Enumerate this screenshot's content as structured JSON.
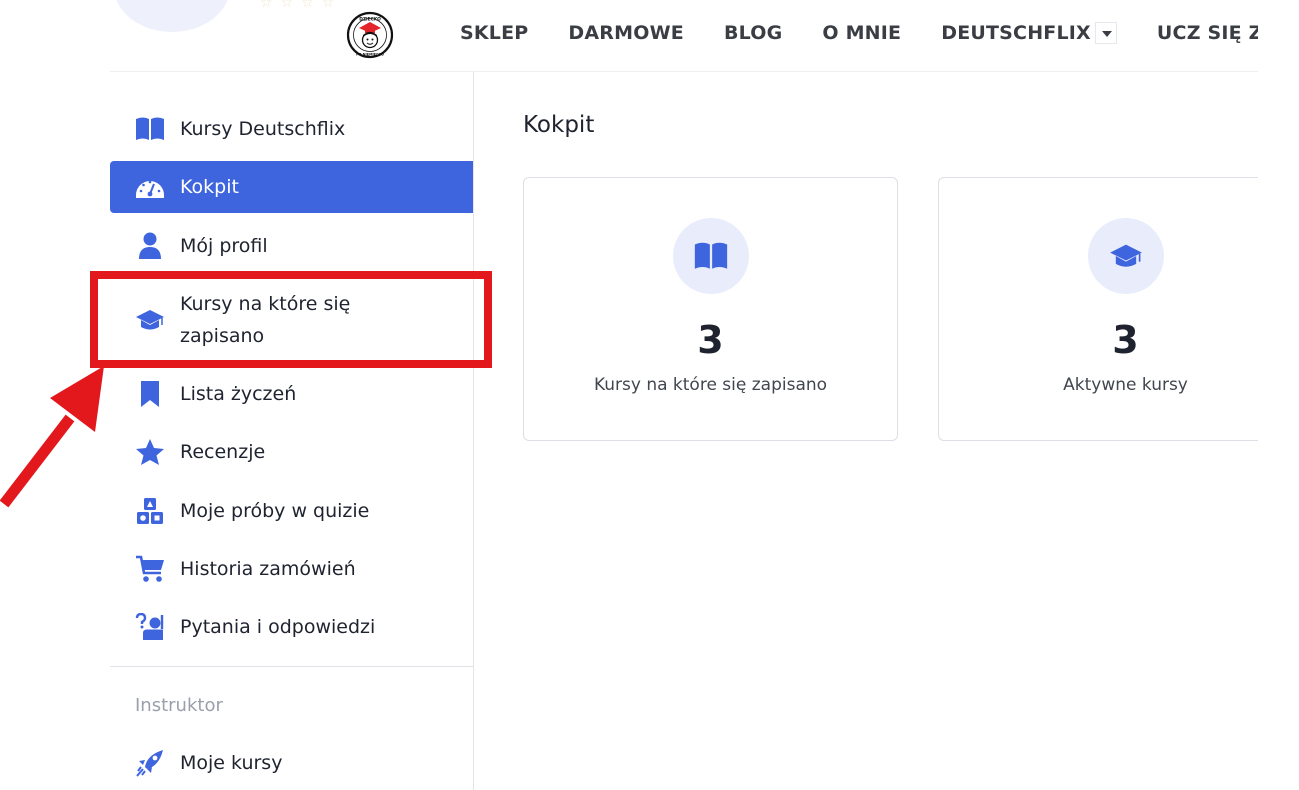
{
  "header": {
    "rating_stars": [
      "☆",
      "☆",
      "☆",
      "☆"
    ],
    "logo": {
      "text_top": "DZIECKO",
      "text_bottom": "PO NIEMIECKU",
      "icon": "graduate-child-logo"
    },
    "nav": [
      {
        "label": "SKLEP"
      },
      {
        "label": "DARMOWE"
      },
      {
        "label": "BLOG"
      },
      {
        "label": "O MNIE"
      },
      {
        "label": "DEUTSCHFLIX",
        "has_dropdown": true
      },
      {
        "label": "UCZ SIĘ ZE"
      }
    ]
  },
  "sidebar": {
    "items": [
      {
        "label": "Kursy Deutschflix",
        "icon": "open-book-icon"
      },
      {
        "label": "Kokpit",
        "icon": "dashboard-gauge-icon",
        "active": true
      },
      {
        "label": "Mój profil",
        "icon": "user-icon"
      },
      {
        "label": "Kursy na które się zapisano",
        "icon": "graduation-cap-icon"
      },
      {
        "label": "Lista życzeń",
        "icon": "bookmark-icon"
      },
      {
        "label": "Recenzje",
        "icon": "star-icon"
      },
      {
        "label": "Moje próby w quizie",
        "icon": "shapes-quiz-icon"
      },
      {
        "label": "Historia zamówień",
        "icon": "shopping-cart-icon"
      },
      {
        "label": "Pytania i odpowiedzi",
        "icon": "question-person-icon"
      }
    ],
    "instructor_section": "Instruktor",
    "instructor_items": [
      {
        "label": "Moje kursy",
        "icon": "rocket-icon"
      }
    ]
  },
  "main": {
    "title": "Kokpit",
    "cards": [
      {
        "value": "3",
        "caption": "Kursy na które się zapisano",
        "icon": "open-book-icon"
      },
      {
        "value": "3",
        "caption": "Aktywne kursy",
        "icon": "graduation-cap-icon"
      }
    ]
  },
  "colors": {
    "accent": "#3e64de",
    "annotation": "#e3181c",
    "icon_bg": "#e9edfb"
  }
}
